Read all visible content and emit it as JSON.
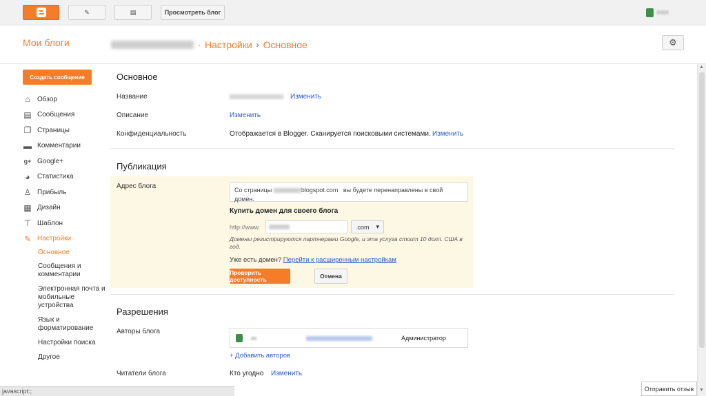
{
  "topbar": {
    "view_blog": "Просмотреть блог",
    "blogger_icon": "blogger-logo-icon",
    "pen_icon": "pencil-icon",
    "posts_icon": "posts-list-icon"
  },
  "header": {
    "my_blogs": "Мои блоги",
    "separator": "·",
    "crumb_settings": "Настройки",
    "crumb_arrow": "›",
    "crumb_current": "Основное",
    "gear_icon": "gear-icon"
  },
  "sidebar": {
    "create_post": "Создать сообщение",
    "items": [
      {
        "label": "Обзор",
        "icon": "home-icon",
        "glyph": "⌂"
      },
      {
        "label": "Сообщения",
        "icon": "posts-icon",
        "glyph": "▤"
      },
      {
        "label": "Страницы",
        "icon": "pages-icon",
        "glyph": "❐"
      },
      {
        "label": "Комментарии",
        "icon": "comments-icon",
        "glyph": "▬"
      },
      {
        "label": "Google+",
        "icon": "google-plus-icon",
        "glyph": "g+"
      },
      {
        "label": "Статистика",
        "icon": "stats-icon",
        "glyph": "◕"
      },
      {
        "label": "Прибыль",
        "icon": "trophy-icon",
        "glyph": "♙"
      },
      {
        "label": "Дизайн",
        "icon": "layout-icon",
        "glyph": "▦"
      },
      {
        "label": "Шаблон",
        "icon": "template-icon",
        "glyph": "⊤"
      },
      {
        "label": "Настройки",
        "icon": "wrench-icon",
        "glyph": "✎"
      }
    ],
    "sub_items": [
      "Основное",
      "Сообщения и комментарии",
      "Электронная почта и мобильные устройства",
      "Язык и форматирование",
      "Настройки поиска",
      "Другое"
    ]
  },
  "basic": {
    "title": "Основное",
    "name_label": "Название",
    "name_change": "Изменить",
    "desc_label": "Описание",
    "desc_change": "Изменить",
    "privacy_label": "Конфиденциальность",
    "privacy_value": "Отображается в Blogger. Сканируется поисковыми системами.",
    "privacy_change": "Изменить"
  },
  "publishing": {
    "title": "Публикация",
    "address_label": "Адрес блога",
    "redirect_prefix": "Со страницы",
    "redirect_domain": "blogspot.com",
    "redirect_suffix": "вы будете перенаправлены в свой домен.",
    "buy_domain": "Купить домен для своего блога",
    "http_prefix": "http://www.",
    "tld": ".com",
    "note": "Домены регистрируются партнерами Google, и эта услуга стоит 10 долл. США в год.",
    "have_domain": "Уже есть домен?",
    "advanced_link": "Перейти к расширенным настройкам",
    "check_button": "Проверить доступность",
    "cancel_button": "Отмена"
  },
  "permissions": {
    "title": "Разрешения",
    "authors_label": "Авторы блога",
    "author_role": "Администратор",
    "add_authors": "+ Добавить авторов",
    "readers_label": "Читатели блога",
    "readers_value": "Кто угодно",
    "readers_change": "Изменить"
  },
  "status": {
    "statusbar": "javascript:;",
    "feedback": "Отправить отзыв"
  }
}
